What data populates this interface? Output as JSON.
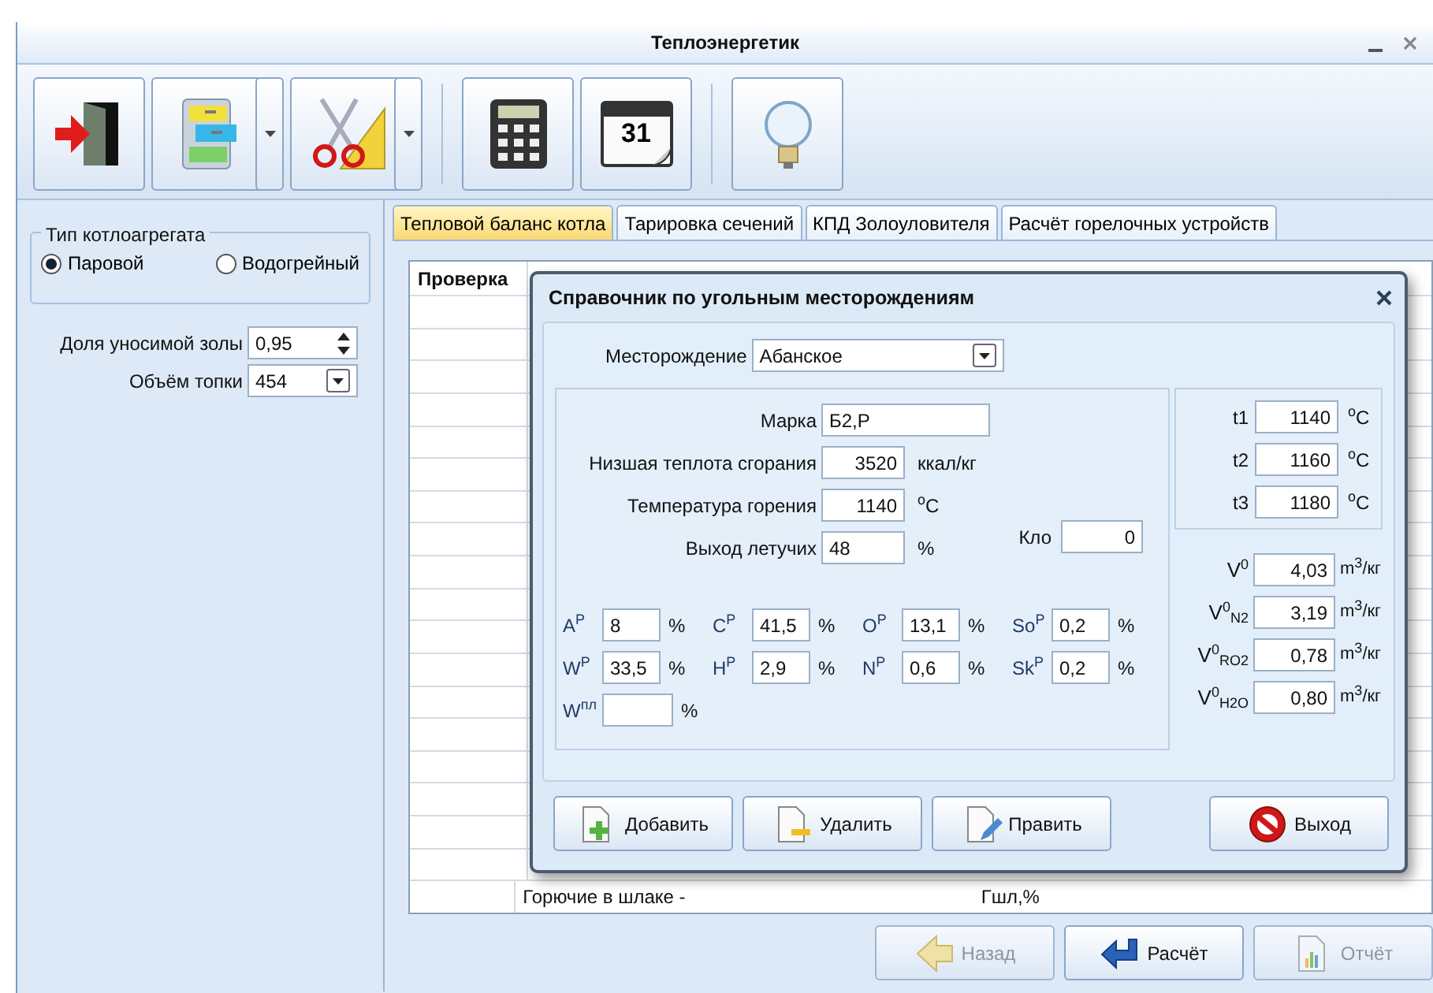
{
  "window": {
    "title": "Теплоэнергетик"
  },
  "toolbar": [
    {
      "kind": "exit",
      "dropdown": false
    },
    {
      "kind": "cabinet",
      "dropdown": true
    },
    {
      "kind": "scissors",
      "dropdown": true
    },
    {
      "kind": "calculator",
      "dropdown": false
    },
    {
      "kind": "calendar",
      "dropdown": false,
      "text": "31"
    },
    {
      "kind": "bulb",
      "dropdown": false
    }
  ],
  "boiler_type": {
    "title": "Тип котлоагрегата",
    "options": [
      {
        "label": "Паровой",
        "selected": true
      },
      {
        "label": "Водогрейный",
        "selected": false
      }
    ]
  },
  "left_fields": [
    {
      "label": "Доля уносимой золы",
      "value": "0,95",
      "kind": "spin"
    },
    {
      "label": "Объём топки",
      "value": "454",
      "kind": "combo"
    }
  ],
  "tabs": [
    {
      "label": "Тепловой баланс котла",
      "selected": true
    },
    {
      "label": "Тарировка сечений",
      "selected": false
    },
    {
      "label": "КПД Золоуловителя",
      "selected": false
    },
    {
      "label": "Расчёт горелочных устройств",
      "selected": false
    }
  ],
  "grid": {
    "column_1": "Проверка",
    "visible_row": {
      "column_2": "Горючие в шлаке -",
      "column_3": "Гшл,%"
    }
  },
  "dialog": {
    "title": "Справочник по угольным месторождениям",
    "deposit": {
      "label": "Месторождение",
      "value": "Абанское"
    },
    "main_fields": [
      {
        "label": "Марка",
        "value": "Б2,Р"
      },
      {
        "label": "Низшая теплота сгорания",
        "value": "3520",
        "unit": "ккал/кг"
      },
      {
        "label": "Температура горения",
        "value": "1140",
        "unit": "$^{o}$C"
      },
      {
        "label": "Выход летучих",
        "value": "48",
        "unit": "%"
      }
    ],
    "klo": {
      "label": "Кло",
      "value": "0"
    },
    "composition": [
      [
        {
          "symbol": "A$^{P}$",
          "value": "8",
          "unit": "%"
        },
        {
          "symbol": "C$^{P}$",
          "value": "41,5",
          "unit": "%"
        },
        {
          "symbol": "O$^{P}$",
          "value": "13,1",
          "unit": "%"
        },
        {
          "symbol": "So$^{P}$",
          "value": "0,2",
          "unit": "%"
        }
      ],
      [
        {
          "symbol": "W$^{P}$",
          "value": "33,5",
          "unit": "%"
        },
        {
          "symbol": "H$^{P}$",
          "value": "2,9",
          "unit": "%"
        },
        {
          "symbol": "N$^{P}$",
          "value": "0,6",
          "unit": "%"
        },
        {
          "symbol": "Sk$^{P}$",
          "value": "0,2",
          "unit": "%"
        }
      ],
      [
        {
          "symbol": "W$^{пл}$",
          "unit": "%"
        }
      ]
    ],
    "temperatures": [
      {
        "label": "t1",
        "value": "1140",
        "unit": "$^{o}$C"
      },
      {
        "label": "t2",
        "value": "1160",
        "unit": "$^{o}$C"
      },
      {
        "label": "t3",
        "value": "1180",
        "unit": "$^{o}$C"
      }
    ],
    "volumes": [
      {
        "label": "V$^{0}$",
        "value": "4,03",
        "unit": "m$^{3}$/кг"
      },
      {
        "label": "V$^{0}$$_{N2}$",
        "value": "3,19",
        "unit": "m$^{3}$/кг"
      },
      {
        "label": "V$^{0}$$_{RO2}$",
        "value": "0,78",
        "unit": "m$^{3}$/кг"
      },
      {
        "label": "V$^{0}$$_{H2O}$",
        "value": "0,80",
        "unit": "m$^{3}$/кг"
      }
    ],
    "buttons": [
      {
        "label": "Добавить",
        "kind": "add"
      },
      {
        "label": "Удалить",
        "kind": "delete"
      },
      {
        "label": "Править",
        "kind": "edit"
      },
      {
        "label": "Выход",
        "kind": "exit"
      }
    ]
  },
  "bottom_buttons": [
    {
      "label": "Назад",
      "kind": "back",
      "disabled": true
    },
    {
      "label": "Расчёт",
      "kind": "calculate",
      "disabled": false
    },
    {
      "label": "Отчёт",
      "kind": "report",
      "disabled": true
    }
  ]
}
